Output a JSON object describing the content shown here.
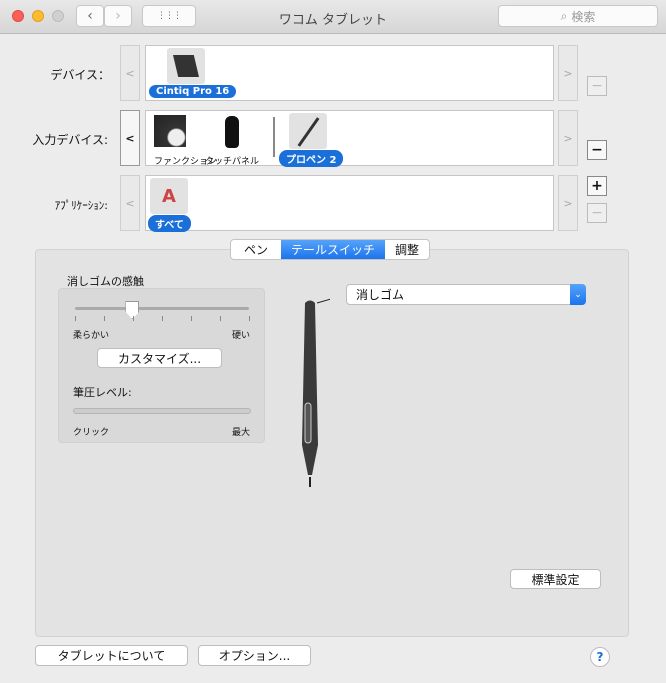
{
  "window": {
    "title": "ワコム タブレット",
    "search_placeholder": "検索",
    "grid_icon": "⋮⋮⋮"
  },
  "rows": {
    "device": {
      "label": "デバイス：",
      "items": [
        {
          "name": "Cintiq Pro 16",
          "selected": true
        }
      ]
    },
    "input": {
      "label": "入力デバイス:",
      "items": [
        {
          "name": "ファンクション"
        },
        {
          "name": "タッチパネル"
        },
        {
          "name": "プロペン 2",
          "selected": true
        }
      ]
    },
    "app": {
      "label": "ｱﾌﾟﾘｹｰｼｮﾝ:",
      "items": [
        {
          "name": "すべて",
          "selected": true
        }
      ]
    }
  },
  "nav": {
    "prev": "<",
    "next": ">",
    "plus": "+",
    "minus": "−"
  },
  "tabs": [
    {
      "label": "ペン"
    },
    {
      "label": "テールスイッチ",
      "selected": true
    },
    {
      "label": "調整"
    }
  ],
  "eraser": {
    "title": "消しゴムの感触",
    "soft": "柔らかい",
    "hard": "硬い",
    "feel_value": 0.33,
    "customize": "カスタマイズ...",
    "pressure_label": "筆圧レベル:",
    "click": "クリック",
    "max": "最大",
    "pressure_value": 0
  },
  "tail_switch": {
    "selected": "消しゴム"
  },
  "buttons": {
    "defaults": "標準設定",
    "about": "タブレットについて",
    "options": "オプション...",
    "help": "?"
  },
  "colors": {
    "accent": "#1a6fd8"
  }
}
